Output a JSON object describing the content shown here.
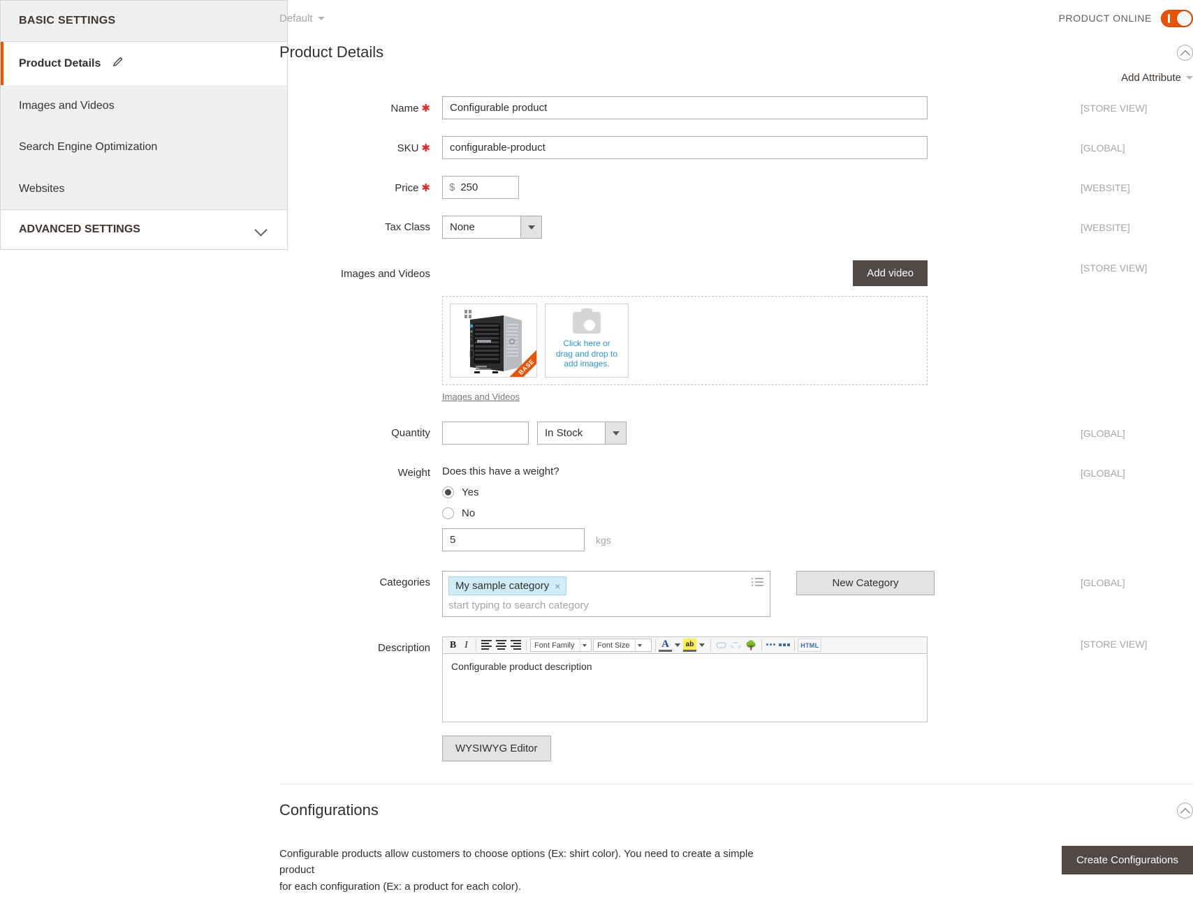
{
  "sidebar": {
    "basic_heading": "BASIC SETTINGS",
    "items": [
      {
        "label": "Product Details",
        "icon": "pencil-icon",
        "active": true
      },
      {
        "label": "Images and Videos",
        "active": false
      },
      {
        "label": "Search Engine Optimization",
        "active": false
      },
      {
        "label": "Websites",
        "active": false
      }
    ],
    "advanced_heading": "ADVANCED SETTINGS"
  },
  "topbar": {
    "store_view": "Default",
    "online_label": "PRODUCT ONLINE",
    "toggle_state": "on"
  },
  "section": {
    "title": "Product Details",
    "add_attribute": "Add Attribute"
  },
  "fields": {
    "name": {
      "label": "Name",
      "required": true,
      "value": "Configurable product",
      "scope": "[STORE VIEW]"
    },
    "sku": {
      "label": "SKU",
      "required": true,
      "value": "configurable-product",
      "scope": "[GLOBAL]"
    },
    "price": {
      "label": "Price",
      "required": true,
      "currency": "$",
      "value": "250",
      "scope": "[WEBSITE]"
    },
    "tax_class": {
      "label": "Tax Class",
      "value": "None",
      "scope": "[WEBSITE]"
    },
    "images": {
      "label": "Images and Videos",
      "scope": "[STORE VIEW]",
      "add_video": "Add video",
      "base_badge": "BASE",
      "dropzone_text": "Click here or drag and drop to add images.",
      "gallery_link": "Images and Videos"
    },
    "quantity": {
      "label": "Quantity",
      "value": "",
      "stock_status": "In Stock",
      "scope": "[GLOBAL]"
    },
    "weight": {
      "label": "Weight",
      "question": "Does this have a weight?",
      "yes_label": "Yes",
      "no_label": "No",
      "selected": "Yes",
      "value": "5",
      "unit": "kgs",
      "scope": "[GLOBAL]"
    },
    "categories": {
      "label": "Categories",
      "chip": "My sample category",
      "chip_remove": "×",
      "placeholder": "start typing to search category",
      "new_category_button": "New Category",
      "scope": "[GLOBAL]"
    },
    "description": {
      "label": "Description",
      "scope": "[STORE VIEW]",
      "value": "Configurable product description",
      "wysiwyg_button": "WYSIWYG Editor",
      "toolbar": {
        "bold": "B",
        "italic": "I",
        "font_family": "Font Family",
        "font_size": "Font Size",
        "text_color": "A",
        "highlight": "ab",
        "html": "HTML"
      }
    }
  },
  "configurations": {
    "title": "Configurations",
    "description_line_1": "Configurable products allow customers to choose options (Ex: shirt color). You need to create a simple product",
    "description_line_2": "for each configuration (Ex: a product for each color).",
    "button": "Create Configurations"
  },
  "colors": {
    "accent": "#eb5202",
    "dark_button": "#514943",
    "link_blue": "#2a98d5",
    "chip_blue": "#d0ecf7"
  }
}
